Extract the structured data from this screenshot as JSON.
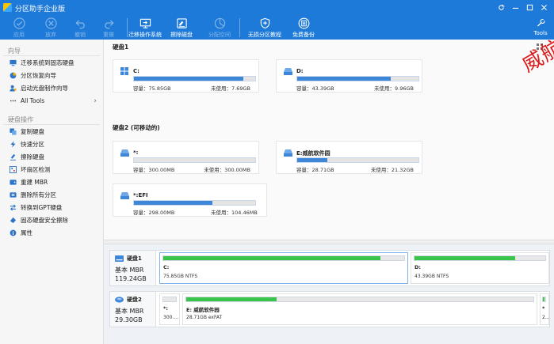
{
  "window": {
    "title": "分区助手企业版"
  },
  "toolbar": {
    "items": [
      {
        "label": "应用",
        "icon": "check-icon",
        "enabled": false
      },
      {
        "label": "放弃",
        "icon": "cancel-icon",
        "enabled": false
      },
      {
        "label": "撤销",
        "icon": "undo-icon",
        "enabled": false
      },
      {
        "label": "重做",
        "icon": "redo-icon",
        "enabled": false
      },
      {
        "label": "迁移操作系统",
        "icon": "migrate-os-icon",
        "enabled": true
      },
      {
        "label": "擦除磁盘",
        "icon": "wipe-disk-icon",
        "enabled": true
      },
      {
        "label": "分配空间",
        "icon": "allocate-space-icon",
        "enabled": false
      },
      {
        "label": "无损分区教程",
        "icon": "shield-plus-icon",
        "enabled": true
      },
      {
        "label": "免费备份",
        "icon": "backup-icon",
        "enabled": true
      }
    ],
    "tools_label": "Tools"
  },
  "sidebar": {
    "wizard_title": "向导",
    "wizard_items": [
      {
        "label": "迁移系统到固态硬盘",
        "icon": "migrate-icon"
      },
      {
        "label": "分区恢复向导",
        "icon": "partition-recovery-icon"
      },
      {
        "label": "启动光盘制作向导",
        "icon": "boot-disc-icon"
      },
      {
        "label": "All Tools",
        "icon": "all-tools-icon"
      }
    ],
    "disk_ops_title": "硬盘操作",
    "disk_ops_items": [
      {
        "label": "复制硬盘",
        "icon": "copy-disk-icon"
      },
      {
        "label": "快速分区",
        "icon": "quick-partition-icon"
      },
      {
        "label": "擦除硬盘",
        "icon": "erase-disk-icon"
      },
      {
        "label": "坏扇区检测",
        "icon": "bad-sector-icon"
      },
      {
        "label": "重建 MBR",
        "icon": "rebuild-mbr-icon"
      },
      {
        "label": "删除所有分区",
        "icon": "delete-partitions-icon"
      },
      {
        "label": "转换到GPT硬盘",
        "icon": "convert-gpt-icon"
      },
      {
        "label": "固态硬盘安全擦除",
        "icon": "ssd-erase-icon"
      },
      {
        "label": "属性",
        "icon": "properties-icon"
      }
    ]
  },
  "main": {
    "disk1": {
      "title": "硬盘1",
      "partitions": [
        {
          "name": "C:",
          "used_fraction": 0.9,
          "capacity": "容量：75.85GB",
          "free": "未使用：7.69GB",
          "icon": "windows-icon"
        },
        {
          "name": "D:",
          "used_fraction": 0.77,
          "capacity": "容量：43.39GB",
          "free": "未使用：9.96GB",
          "icon": "drive-icon"
        }
      ]
    },
    "disk2": {
      "title": "硬盘2 (可移动的)",
      "partitions": [
        {
          "name": "*:",
          "used_fraction": 0.0,
          "capacity": "容量：300.00MB",
          "free": "未使用：300.00MB",
          "icon": "drive-icon"
        },
        {
          "name": "E:威航软件园",
          "used_fraction": 0.25,
          "capacity": "容量：28.71GB",
          "free": "未使用：21.32GB",
          "icon": "drive-icon"
        },
        {
          "name": "*:EFI",
          "used_fraction": 0.65,
          "capacity": "容量：298.00MB",
          "free": "未使用：104.46MB",
          "icon": "drive-icon"
        }
      ]
    },
    "watermark": "威航软件园"
  },
  "bottom": {
    "disks": [
      {
        "name": "硬盘1",
        "type": "基本 MBR",
        "size": "119.24GB",
        "partitions": [
          {
            "label": "C:",
            "info": "75.85GB NTFS",
            "used_fraction": 0.9
          },
          {
            "label": "D:",
            "info": "43.39GB NTFS",
            "used_fraction": 0.77
          }
        ]
      },
      {
        "name": "硬盘2",
        "type": "基本 MBR",
        "size": "29.30GB",
        "partitions": [
          {
            "label": "*:",
            "info": "300....",
            "used_fraction": 0.0
          },
          {
            "label": "E: 威航软件园",
            "info": "28.71GB exFAT",
            "used_fraction": 0.26
          },
          {
            "label": "*",
            "info": "2...",
            "used_fraction": 0.65
          }
        ]
      }
    ]
  },
  "colors": {
    "titlebar": "#1e7ad8",
    "bar_blue": "#3d86d8",
    "bar_green": "#39c44a",
    "watermark": "#d81e1e"
  }
}
